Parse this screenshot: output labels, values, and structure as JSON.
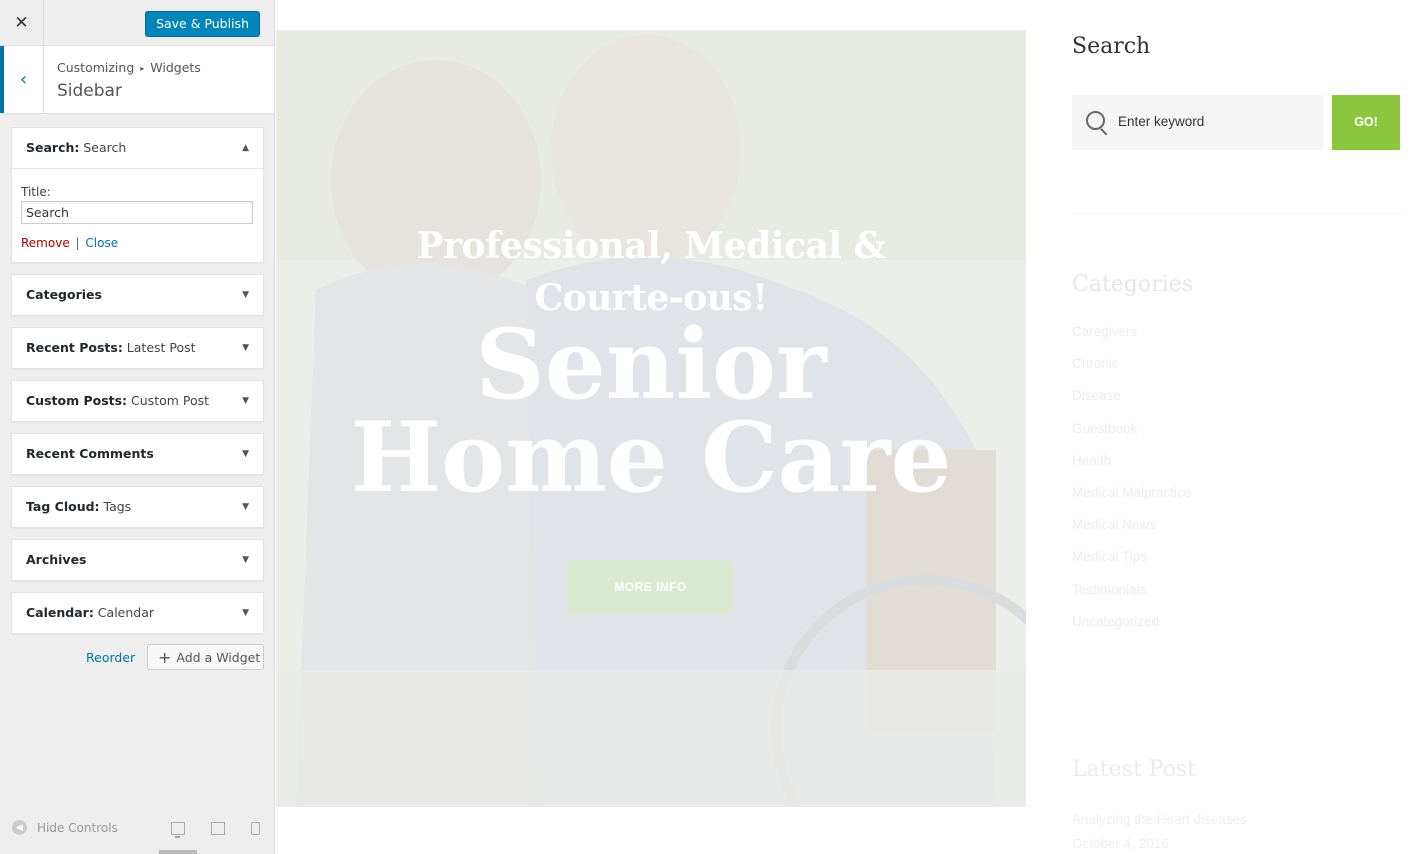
{
  "customizer": {
    "close_label": "✕",
    "save_label": "Save & Publish",
    "back_label": "‹",
    "breadcrumb": {
      "root": "Customizing",
      "sep": "▸",
      "current": "Widgets"
    },
    "section_title": "Sidebar",
    "widgets": [
      {
        "name": "Search:",
        "sub": " Search",
        "open": true
      },
      {
        "name": "Categories",
        "sub": ""
      },
      {
        "name": "Recent Posts:",
        "sub": " Latest Post"
      },
      {
        "name": "Custom Posts:",
        "sub": " Custom Post"
      },
      {
        "name": "Recent Comments",
        "sub": ""
      },
      {
        "name": "Tag Cloud:",
        "sub": " Tags"
      },
      {
        "name": "Archives",
        "sub": ""
      },
      {
        "name": "Calendar:",
        "sub": " Calendar"
      }
    ],
    "search_widget": {
      "title_label": "Title:",
      "title_value": "Search",
      "remove": "Remove",
      "pipe": "|",
      "close": "Close"
    },
    "reorder_label": "Reorder",
    "add_widget_label": "Add a Widget",
    "add_widget_plus": "+",
    "hide_controls_label": "Hide Controls"
  },
  "preview": {
    "hero": {
      "tagline": "Professional, Medical & Courte-ous!",
      "title_line1": "Senior",
      "title_line2": "Home Care",
      "button": "MORE INFO"
    },
    "sidebar": {
      "search_title": "Search",
      "search_placeholder": "Enter keyword",
      "go_label": "GO!",
      "categories_title": "Categories",
      "categories": [
        "Caregivers",
        "Chronic",
        "Disease",
        "Guestbook",
        "Health",
        "Medical Malpractice",
        "Medical News",
        "Medical Tips",
        "Testimonials",
        "Uncategorized"
      ],
      "latest_title": "Latest Post",
      "latest_item": "Analyzing the Heart diseases",
      "latest_item2": "October 4, 2016"
    }
  },
  "colors": {
    "accent": "#0085ba",
    "link": "#0073aa",
    "remove": "#aa0000",
    "go": "#8cc63f"
  }
}
